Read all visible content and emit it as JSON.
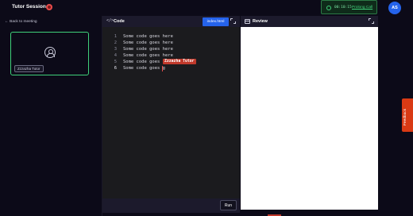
{
  "header": {
    "title": "Tutor Session",
    "timer": "00:10:15",
    "prolong_label": "Prolong Call",
    "avatar_initials": "AS"
  },
  "sidebar": {
    "back_label": "← Back to meeting",
    "participant_name": "Zzzazha Tutor"
  },
  "code_panel": {
    "title": "Code",
    "icon": "</>",
    "file_tab": "index.html",
    "lines": [
      {
        "no": "1",
        "text": "Some code goes here"
      },
      {
        "no": "2",
        "text": "Some code goes here"
      },
      {
        "no": "3",
        "text": "Some code goes here"
      },
      {
        "no": "4",
        "text": "Some code goes here"
      },
      {
        "no": "5",
        "text": "Some code goes h"
      },
      {
        "no": "6",
        "text": "Some code goes g"
      }
    ],
    "remote_cursor_label": "Zzzazha Tutor",
    "run_label": "Run"
  },
  "review_panel": {
    "title": "Review"
  },
  "feedback": {
    "label": "Feedback"
  },
  "colors": {
    "background": "#0c0a18",
    "accent_blue": "#2563eb",
    "success_green": "#3fd17a",
    "cursor_red": "#c0392b",
    "feedback_orange": "#d93a14"
  }
}
